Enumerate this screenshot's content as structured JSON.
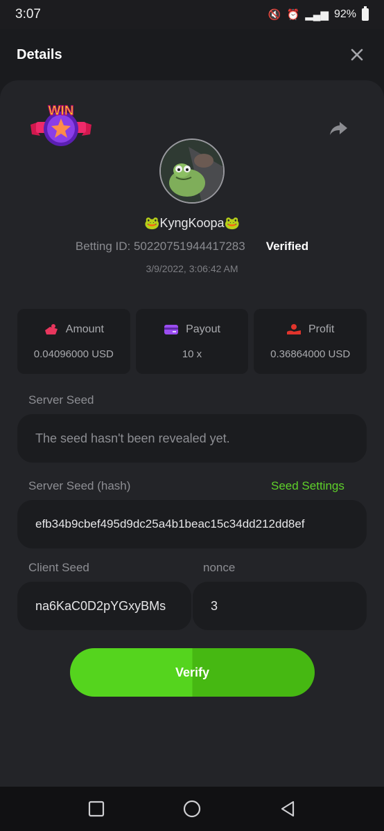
{
  "status_bar": {
    "time": "3:07",
    "battery_text": "92%"
  },
  "header": {
    "title": "Details",
    "close_icon": "close-icon"
  },
  "bet": {
    "badge_text": "WIN",
    "username": "🐸KyngKoopa🐸",
    "betting_id": "Betting ID: 50220751944417283",
    "verified_label": "Verified",
    "timestamp": "3/9/2022, 3:06:42 AM"
  },
  "stats": [
    {
      "icon": "amount-icon",
      "label": "Amount",
      "value": "0.04096000 USD",
      "color": "#e8365d"
    },
    {
      "icon": "payout-icon",
      "label": "Payout",
      "value": "10 x",
      "color": "#9b4df0"
    },
    {
      "icon": "profit-icon",
      "label": "Profit",
      "value": "0.36864000 USD",
      "color": "#e0342c"
    }
  ],
  "server_seed": {
    "label": "Server Seed",
    "value": "The seed hasn't been revealed yet."
  },
  "server_seed_hash": {
    "label": "Server Seed (hash)",
    "link": "Seed Settings",
    "value": "efb34b9cbef495d9dc25a4b1beac15c34dd212dd8ef"
  },
  "client_seed": {
    "label": "Client Seed",
    "value": "na6KaC0D2pYGxyBMs"
  },
  "nonce": {
    "label": "nonce",
    "value": "3"
  },
  "verify_button": "Verify",
  "colors": {
    "accent_green": "#55d41e",
    "link_green": "#5fd12a",
    "background": "#1a1b1e",
    "panel": "#232428"
  }
}
